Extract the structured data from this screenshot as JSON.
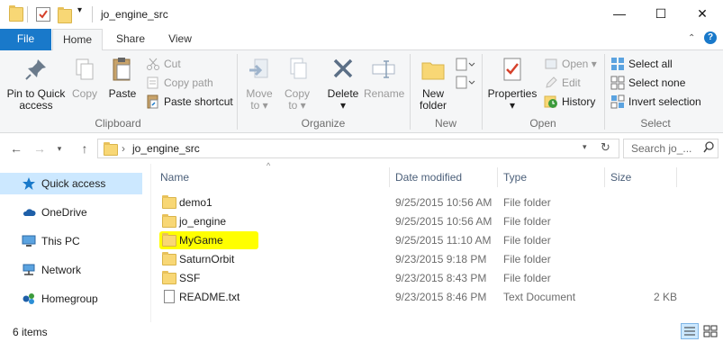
{
  "window": {
    "title": "jo_engine_src",
    "minimize_glyph": "—",
    "maximize_glyph": "☐",
    "close_glyph": "✕"
  },
  "tabs": [
    {
      "label": "File"
    },
    {
      "label": "Home"
    },
    {
      "label": "Share"
    },
    {
      "label": "View"
    }
  ],
  "ribbon": {
    "groups": {
      "clipboard": "Clipboard",
      "organize": "Organize",
      "new": "New",
      "open": "Open",
      "select": "Select"
    },
    "pin_label_1": "Pin to Quick",
    "pin_label_2": "access",
    "copy": "Copy",
    "paste": "Paste",
    "cut": "Cut",
    "copy_path": "Copy path",
    "paste_shortcut": "Paste shortcut",
    "move_to_1": "Move",
    "move_to_2": "to ▾",
    "copy_to_1": "Copy",
    "copy_to_2": "to ▾",
    "delete": "Delete",
    "delete_arrow": "▾",
    "rename": "Rename",
    "new_folder_1": "New",
    "new_folder_2": "folder",
    "properties": "Properties",
    "properties_arrow": "▾",
    "open": "Open ▾",
    "edit": "Edit",
    "history": "History",
    "select_all": "Select all",
    "select_none": "Select none",
    "invert_selection": "Invert selection"
  },
  "address": {
    "path": "jo_engine_src",
    "search_placeholder": "Search jo_..."
  },
  "nav": [
    {
      "label": "Quick access",
      "icon": "star-icon"
    },
    {
      "label": "OneDrive",
      "icon": "cloud-icon"
    },
    {
      "label": "This PC",
      "icon": "computer-icon"
    },
    {
      "label": "Network",
      "icon": "network-icon"
    },
    {
      "label": "Homegroup",
      "icon": "homegroup-icon"
    }
  ],
  "columns": {
    "name": "Name",
    "date": "Date modified",
    "type": "Type",
    "size": "Size"
  },
  "files": [
    {
      "name": "demo1",
      "date": "9/25/2015 10:56 AM",
      "type": "File folder",
      "size": ""
    },
    {
      "name": "jo_engine",
      "date": "9/25/2015 10:56 AM",
      "type": "File folder",
      "size": ""
    },
    {
      "name": "MyGame",
      "date": "9/25/2015 11:10 AM",
      "type": "File folder",
      "size": ""
    },
    {
      "name": "SaturnOrbit",
      "date": "9/23/2015 9:18 PM",
      "type": "File folder",
      "size": ""
    },
    {
      "name": "SSF",
      "date": "9/23/2015 8:43 PM",
      "type": "File folder",
      "size": ""
    },
    {
      "name": "README.txt",
      "date": "9/23/2015 8:46 PM",
      "type": "Text Document",
      "size": "2 KB"
    }
  ],
  "status": {
    "item_count": "6 items"
  },
  "colors": {
    "file_tab": "#1979ca",
    "selection": "#cce8ff",
    "highlight": "#ffff00",
    "folder": "#f8d775"
  }
}
